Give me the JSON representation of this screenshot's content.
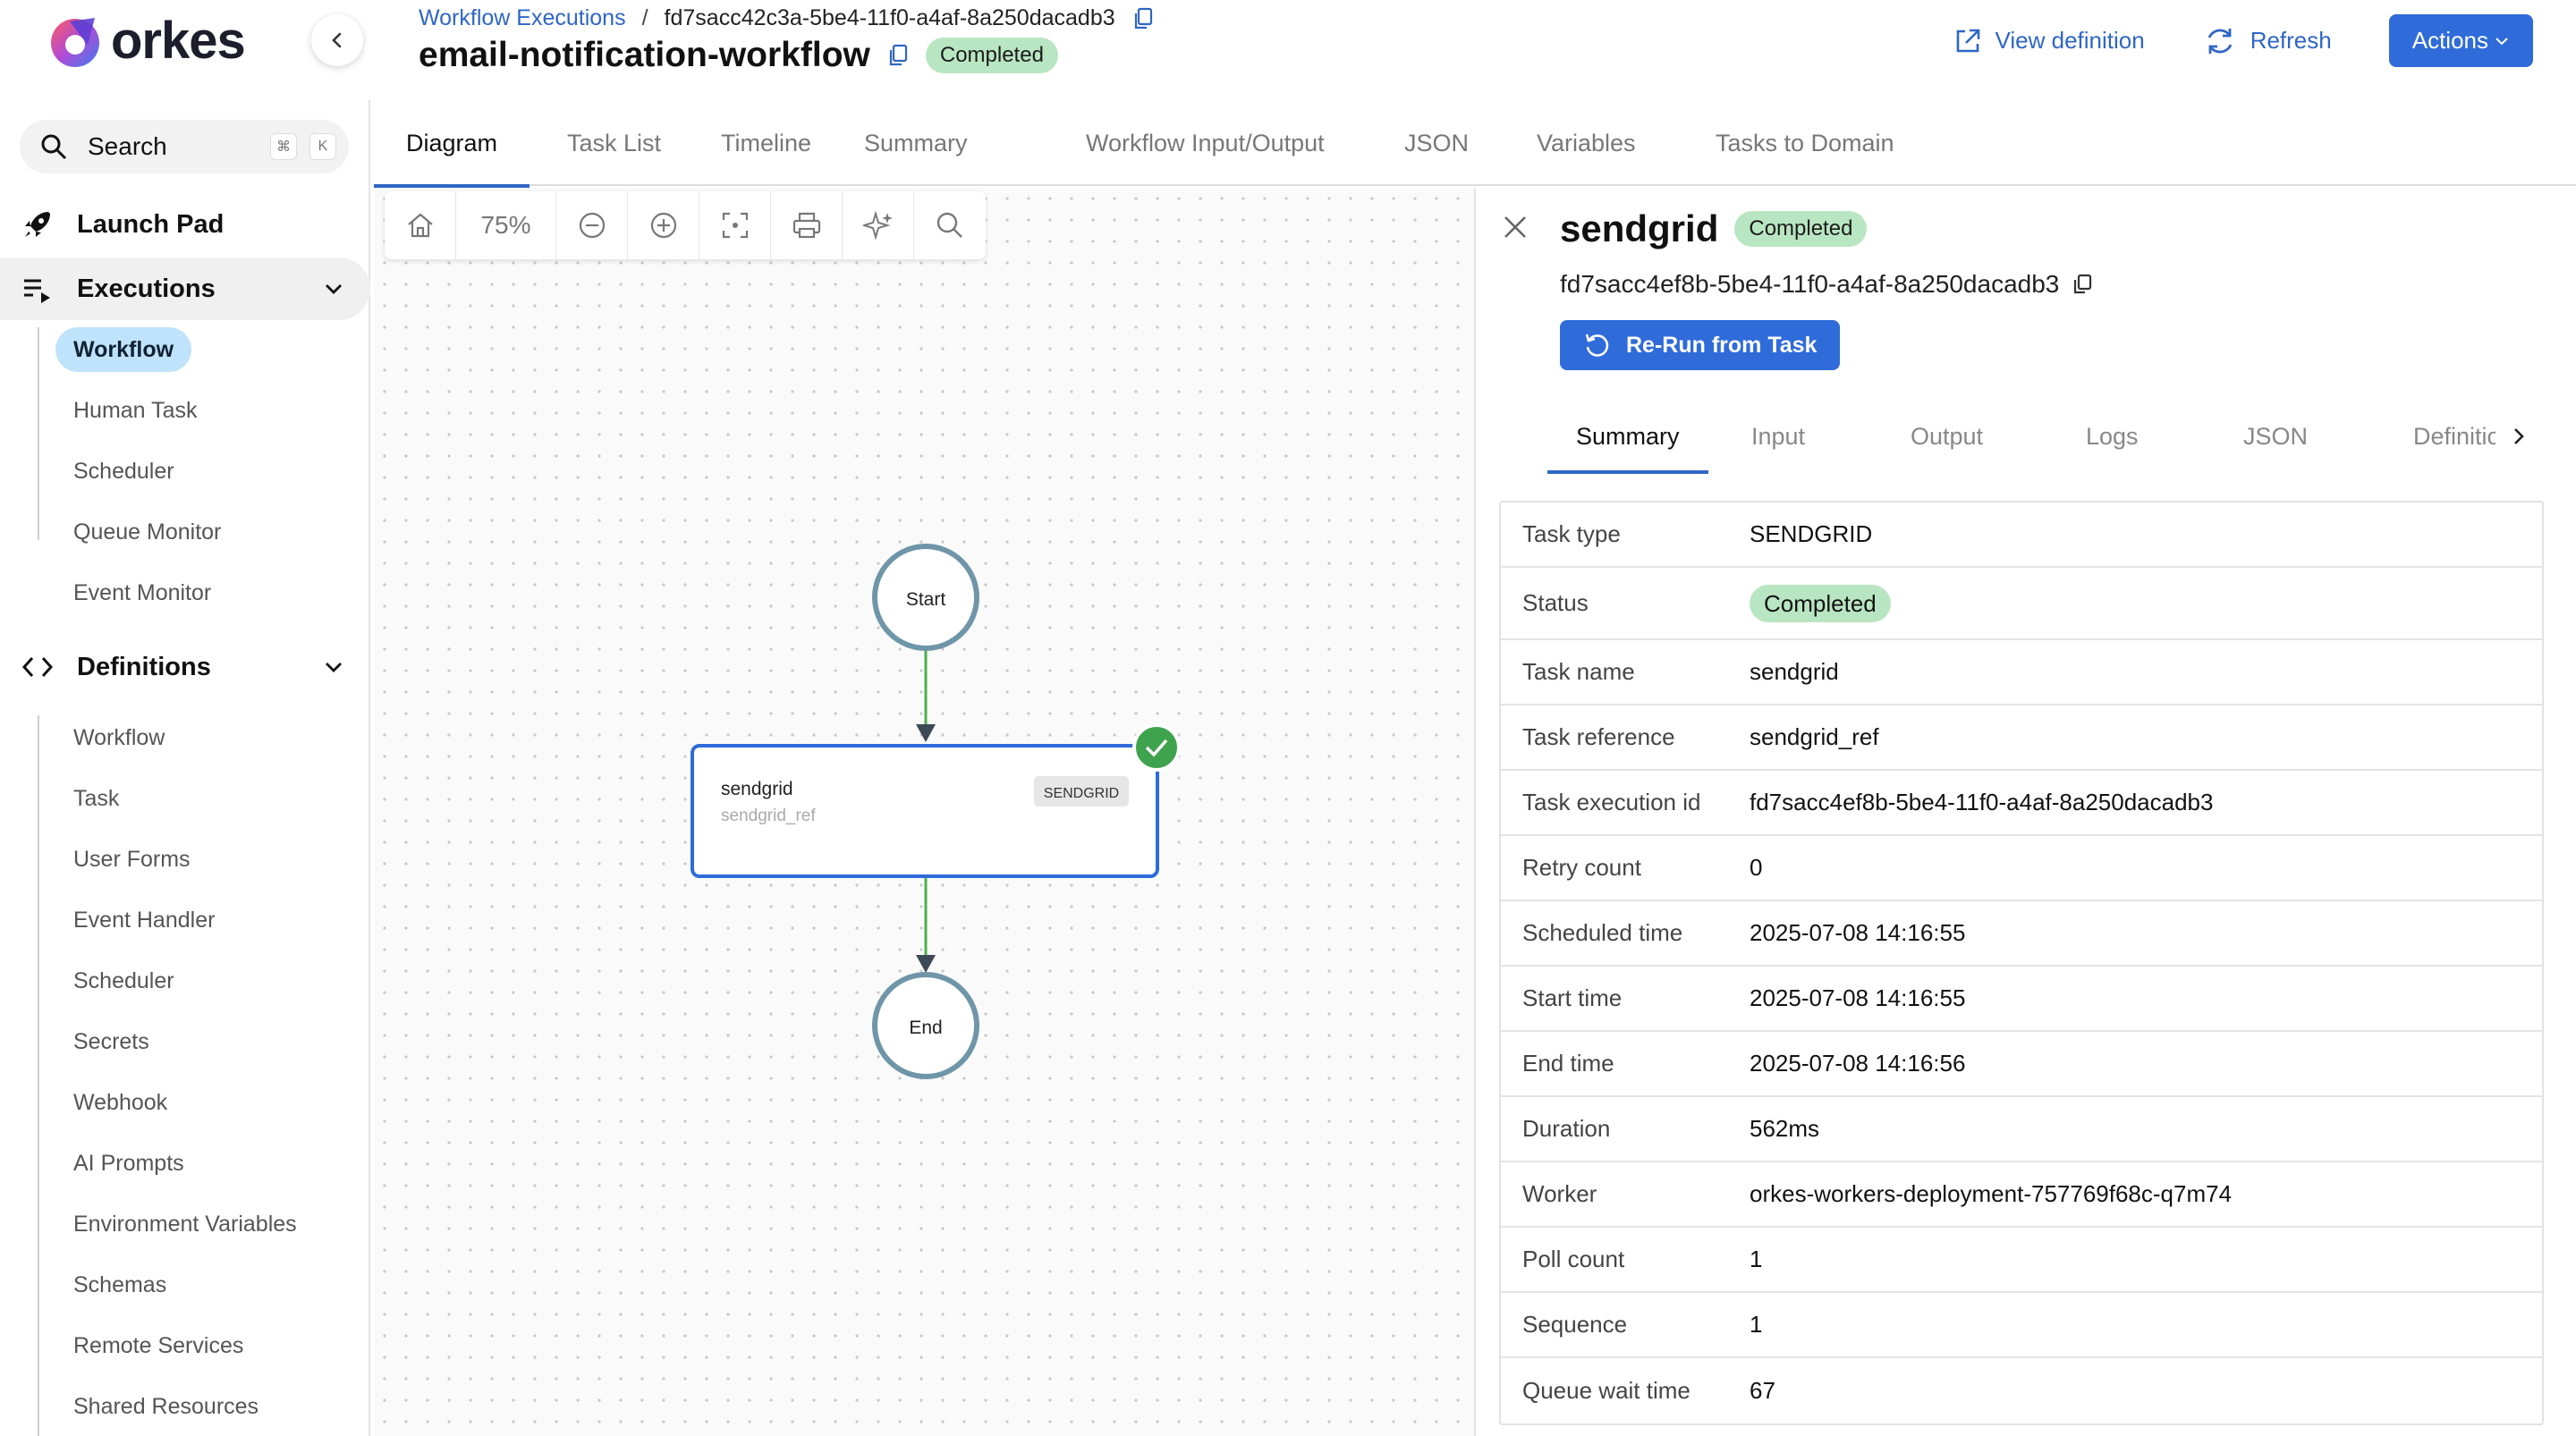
{
  "app": {
    "name": "orkes"
  },
  "header": {
    "breadcrumb_link": "Workflow Executions",
    "breadcrumb_sep": "/",
    "breadcrumb_current": "fd7sacc42c3a-5be4-11f0-a4af-8a250dacadb3",
    "workflow_title": "email-notification-workflow",
    "status": "Completed",
    "view_definition": "View definition",
    "refresh": "Refresh",
    "actions": "Actions"
  },
  "sidebar": {
    "search_label": "Search",
    "kbd_cmd": "⌘",
    "kbd_k": "K",
    "launch_pad": "Launch Pad",
    "executions": {
      "label": "Executions",
      "items": [
        "Workflow",
        "Human Task",
        "Scheduler",
        "Queue Monitor",
        "Event Monitor"
      ]
    },
    "definitions": {
      "label": "Definitions",
      "items": [
        "Workflow",
        "Task",
        "User Forms",
        "Event Handler",
        "Scheduler",
        "Secrets",
        "Webhook",
        "AI Prompts",
        "Environment Variables",
        "Schemas",
        "Remote Services",
        "Shared Resources"
      ]
    }
  },
  "tabs": [
    "Diagram",
    "Task List",
    "Timeline",
    "Summary",
    "Workflow Input/Output",
    "JSON",
    "Variables",
    "Tasks to Domain"
  ],
  "canvas": {
    "zoom": "75%",
    "start_label": "Start",
    "end_label": "End",
    "task_name": "sendgrid",
    "task_ref": "sendgrid_ref",
    "task_type_tag": "SENDGRID"
  },
  "panel": {
    "title": "sendgrid",
    "status": "Completed",
    "task_id": "fd7sacc4ef8b-5be4-11f0-a4af-8a250dacadb3",
    "rerun": "Re-Run from Task",
    "tabs": [
      "Summary",
      "Input",
      "Output",
      "Logs",
      "JSON",
      "Definition"
    ],
    "details": [
      {
        "key": "Task type",
        "value": "SENDGRID"
      },
      {
        "key": "Status",
        "value": "Completed"
      },
      {
        "key": "Task name",
        "value": "sendgrid"
      },
      {
        "key": "Task reference",
        "value": "sendgrid_ref"
      },
      {
        "key": "Task execution id",
        "value": "fd7sacc4ef8b-5be4-11f0-a4af-8a250dacadb3"
      },
      {
        "key": "Retry count",
        "value": "0"
      },
      {
        "key": "Scheduled time",
        "value": "2025-07-08 14:16:55"
      },
      {
        "key": "Start time",
        "value": "2025-07-08 14:16:55"
      },
      {
        "key": "End time",
        "value": "2025-07-08 14:16:56"
      },
      {
        "key": "Duration",
        "value": "562ms"
      },
      {
        "key": "Worker",
        "value": "orkes-workers-deployment-757769f68c-q7m74"
      },
      {
        "key": "Poll count",
        "value": "1"
      },
      {
        "key": "Sequence",
        "value": "1"
      },
      {
        "key": "Queue wait time",
        "value": "67"
      }
    ]
  },
  "colors": {
    "accent": "#2f66c4",
    "button": "#2f6bd9",
    "success_badge": "#b9e6c2",
    "success_edge": "#4caf50",
    "node_stroke": "#6f96a8",
    "task_border": "#2f6bd9"
  }
}
